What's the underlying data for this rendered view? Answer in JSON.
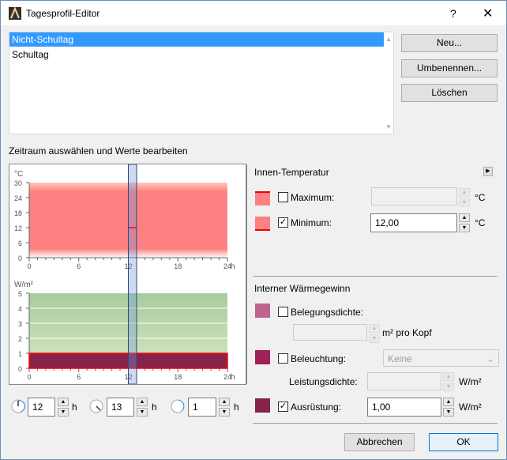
{
  "window": {
    "title": "Tagesprofil-Editor",
    "help": "?",
    "close": "✕"
  },
  "profiles": {
    "items": [
      "Nicht-Schultag",
      "Schultag"
    ],
    "selected": 0
  },
  "buttons": {
    "new": "Neu...",
    "rename": "Umbenennen...",
    "delete": "Löschen",
    "cancel": "Abbrechen",
    "ok": "OK"
  },
  "section_label": "Zeitraum auswählen und Werte bearbeiten",
  "temperature": {
    "heading": "Innen-Temperatur",
    "maximum_label": "Maximum:",
    "maximum_checked": false,
    "maximum_value": "",
    "minimum_label": "Minimum:",
    "minimum_checked": true,
    "minimum_value": "12,00",
    "unit": "°C"
  },
  "gains": {
    "heading": "Interner Wärmegewinn",
    "occupancy_label": "Belegungsdichte:",
    "occupancy_checked": false,
    "occupancy_value": "",
    "occupancy_unit": "m² pro Kopf",
    "lighting_label": "Beleuchtung:",
    "lighting_checked": false,
    "lighting_select": "Keine",
    "power_label": "Leistungsdichte:",
    "power_value": "",
    "power_unit": "W/m²",
    "equipment_label": "Ausrüstung:",
    "equipment_checked": true,
    "equipment_value": "1,00",
    "equipment_unit": "W/m²"
  },
  "time": {
    "start": "12",
    "end": "13",
    "duration": "1",
    "unit": "h"
  },
  "colors": {
    "selection": "#3399ff",
    "temp": "#ff8080",
    "occupancy": "#be6590",
    "lighting": "#a0205a",
    "equipment": "#84244a"
  },
  "chart_data": [
    {
      "type": "area",
      "title": "",
      "ylabel": "°C",
      "xlabel": "h",
      "xlim": [
        0,
        24
      ],
      "ylim": [
        0,
        30
      ],
      "xticks": [
        "0",
        "6",
        "12",
        "18",
        "24"
      ],
      "yticks": [
        "0",
        "6",
        "12",
        "18",
        "24",
        "30"
      ],
      "series": [
        {
          "name": "Minimum",
          "x": [
            12,
            13
          ],
          "y": [
            12,
            12
          ]
        }
      ],
      "selection": [
        12,
        13
      ]
    },
    {
      "type": "area",
      "title": "",
      "ylabel": "W/m²",
      "xlabel": "h",
      "xlim": [
        0,
        24
      ],
      "ylim": [
        0,
        5
      ],
      "xticks": [
        "0",
        "6",
        "12",
        "18",
        "24"
      ],
      "yticks": [
        "0",
        "1",
        "2",
        "3",
        "4",
        "5"
      ],
      "series": [
        {
          "name": "Ausrüstung",
          "x": [
            0,
            24
          ],
          "y": [
            1,
            1
          ]
        }
      ],
      "selection": [
        12,
        13
      ]
    }
  ]
}
